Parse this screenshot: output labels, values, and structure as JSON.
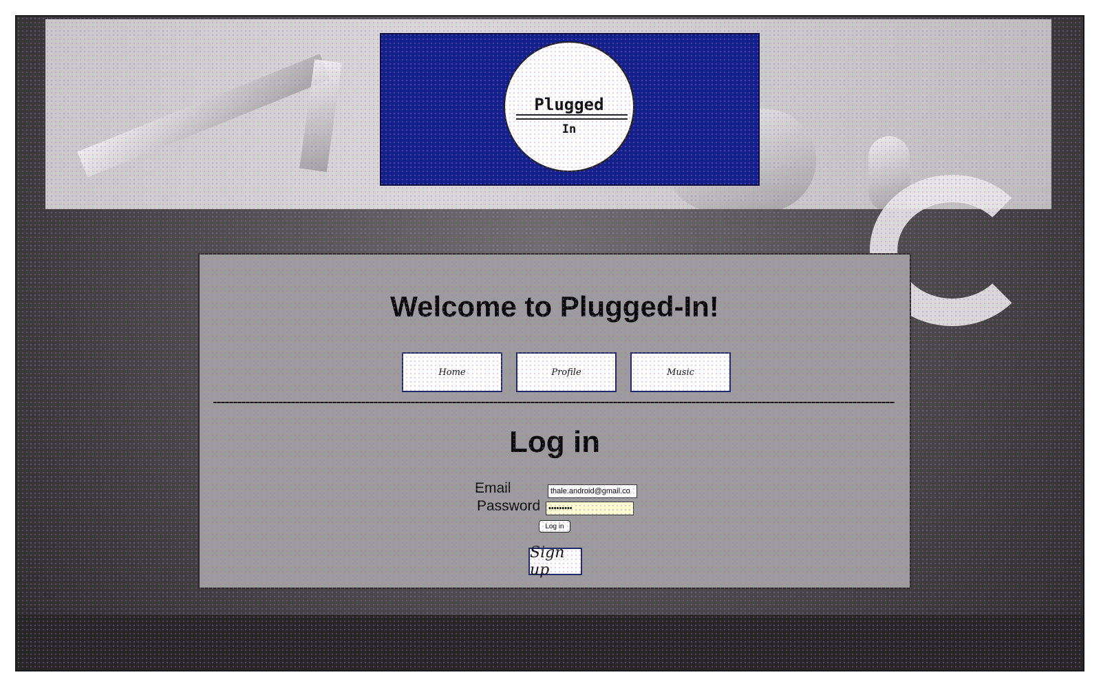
{
  "logo": {
    "line1": "Plugged",
    "line2": "In"
  },
  "welcome": {
    "title": "Welcome to Plugged-In!"
  },
  "nav": {
    "items": [
      {
        "label": "Home"
      },
      {
        "label": "Profile"
      },
      {
        "label": "Music"
      }
    ]
  },
  "login": {
    "title": "Log in",
    "email_label": "Email",
    "email_value": "thale.android@gmail.co",
    "password_label": "Password",
    "password_value": "•••••••••",
    "submit_label": "Log in"
  },
  "signup": {
    "label": "Sign up"
  },
  "colors": {
    "logo_panel": "#14208a",
    "content_panel": "#9c9c9c",
    "password_field": "#fbfbd0"
  }
}
